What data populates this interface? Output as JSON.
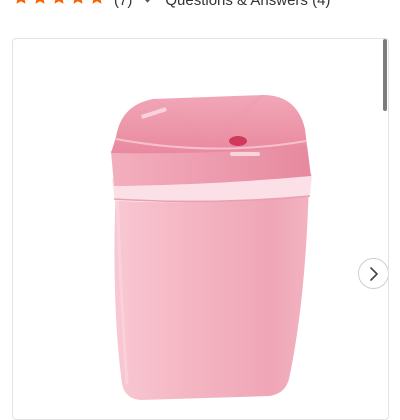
{
  "rating": {
    "stars": 5,
    "star_color": "#f96302",
    "count_label": "(7)",
    "qa_label": "Questions & Answers (4)"
  },
  "gallery": {
    "image_alt": "pink rectangular motion sensor trash can",
    "next_icon": "chevron-right-icon",
    "product_color": "#f4b6c4"
  }
}
